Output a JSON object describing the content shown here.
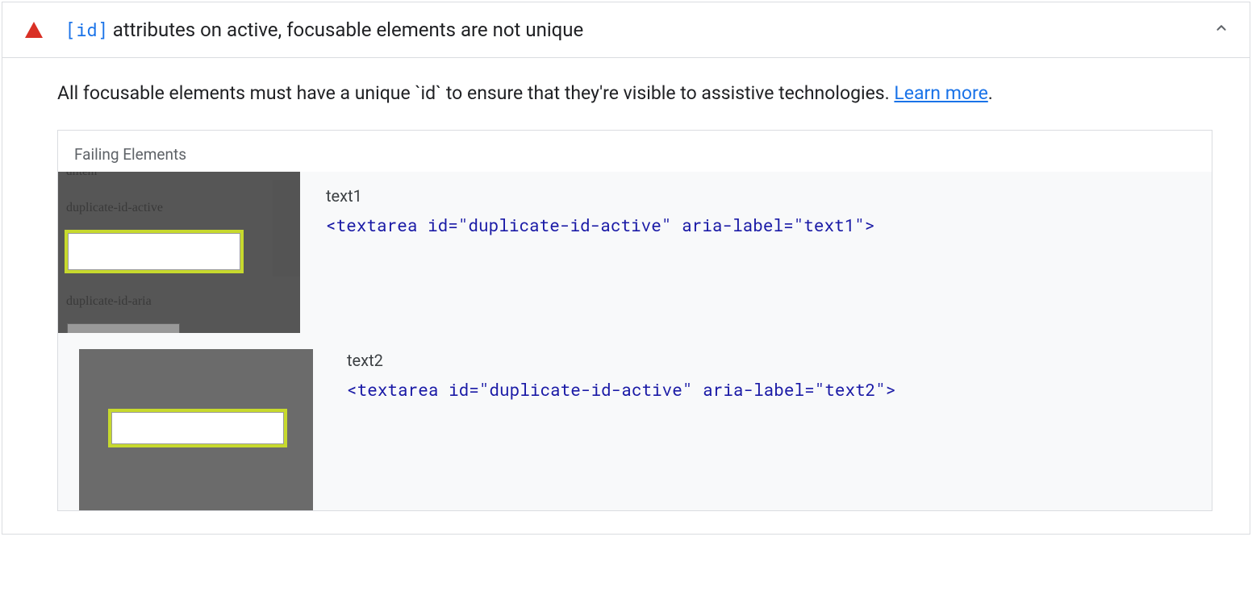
{
  "header": {
    "code_attr": "[id]",
    "title_suffix": " attributes on active, focusable elements are not unique"
  },
  "description": {
    "text_before": "All focusable elements must have a unique ",
    "code_word": "`id`",
    "text_after": " to ensure that they're visible to assistive technologies. ",
    "learn_more_label": "Learn more",
    "period": "."
  },
  "failing": {
    "title": "Failing Elements",
    "items": [
      {
        "label": "text1",
        "code": "<textarea id=\"duplicate-id-active\" aria-label=\"text1\">",
        "thumb_labels": {
          "top_cut": "dlitem",
          "mid": "duplicate-id-active",
          "bottom": "duplicate-id-aria"
        }
      },
      {
        "label": "text2",
        "code": "<textarea id=\"duplicate-id-active\" aria-label=\"text2\">"
      }
    ]
  }
}
